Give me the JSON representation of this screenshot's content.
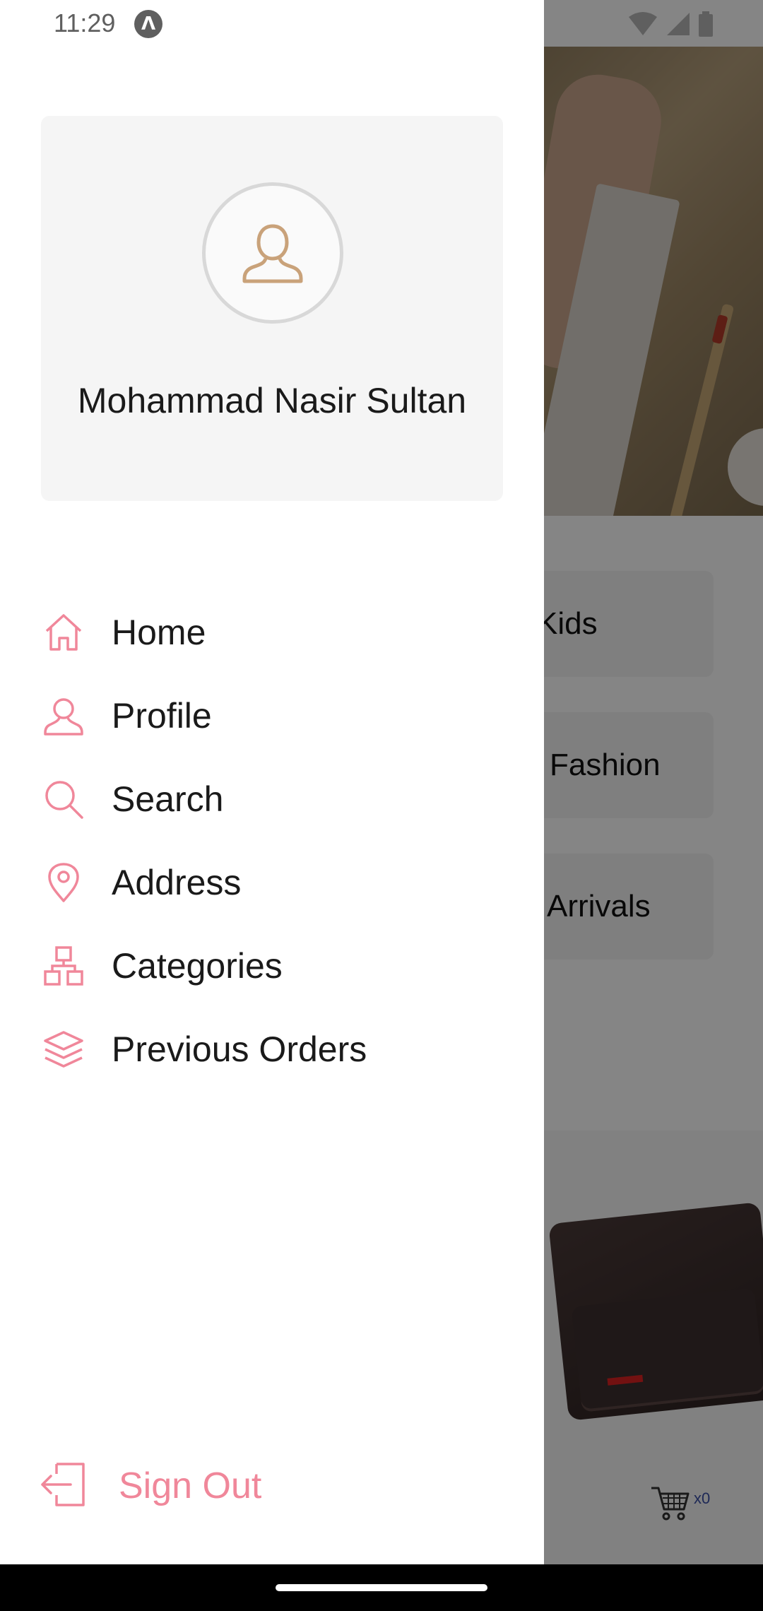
{
  "status_bar": {
    "time": "11:29",
    "app_icon_glyph": "Λ",
    "icons": [
      "wifi-icon",
      "signal-icon",
      "battery-icon"
    ]
  },
  "drawer": {
    "user_name": "Mohammad Nasir Sultan",
    "avatar_icon": "user-outline-icon",
    "menu": [
      {
        "label": "Home",
        "icon": "home-icon"
      },
      {
        "label": "Profile",
        "icon": "user-icon"
      },
      {
        "label": "Search",
        "icon": "search-icon"
      },
      {
        "label": "Address",
        "icon": "location-pin-icon"
      },
      {
        "label": "Categories",
        "icon": "categories-icon"
      },
      {
        "label": "Previous Orders",
        "icon": "layers-icon"
      }
    ],
    "sign_out_label": "Sign Out",
    "sign_out_icon": "sign-out-icon"
  },
  "background": {
    "categories": [
      "Kids",
      "Fashion",
      "Arrivals"
    ],
    "cart_count": "x0"
  },
  "colors": {
    "accent_pink": "#f0879a",
    "avatar_tan": "#c9a27a",
    "card_bg": "#f5f5f5",
    "cart_blue": "#3b4fa6"
  }
}
